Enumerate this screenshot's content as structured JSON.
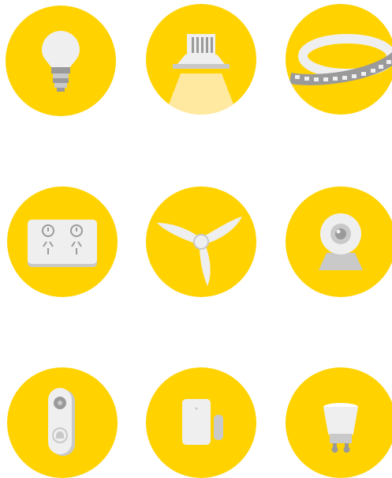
{
  "colors": {
    "accent": "#FFD200",
    "device_light": "#EFEFEF",
    "device_shade": "#C9C9C9",
    "device_dark": "#9A9A9A",
    "glow": "#FFE9A0"
  },
  "tiles": [
    {
      "icon": "light-bulb-icon"
    },
    {
      "icon": "downlight-icon"
    },
    {
      "icon": "led-strip-icon"
    },
    {
      "icon": "double-power-outlet-icon"
    },
    {
      "icon": "ceiling-fan-icon"
    },
    {
      "icon": "security-camera-icon"
    },
    {
      "icon": "video-doorbell-icon"
    },
    {
      "icon": "door-sensor-icon"
    },
    {
      "icon": "gu10-bulb-icon"
    }
  ]
}
